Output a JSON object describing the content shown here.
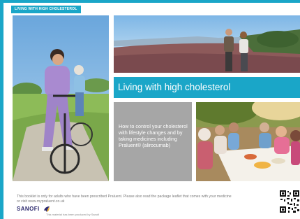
{
  "tag": {
    "label": "LIVING WITH HIGH CHOLESTEROL"
  },
  "title": "Living with high cholesterol",
  "intro": "How to control your cholesterol with lifestyle changes and by taking medicines including Praluent® (alirocumab)",
  "disclaimer": "This booklet is only for adults who have been prescribed Praluent. Please also read the package leaflet that comes with your medicine or visit www.mypraluent.co.uk",
  "brand": {
    "logo": "SANOFI",
    "note": "This material has been produced by Sanofi"
  },
  "colors": {
    "accent": "#1aa6c8",
    "grey_panel": "#a6a6a6",
    "brand": "#2d2a6e"
  },
  "icons": [
    "sanofi-bird-icon",
    "qr-code-icon"
  ]
}
